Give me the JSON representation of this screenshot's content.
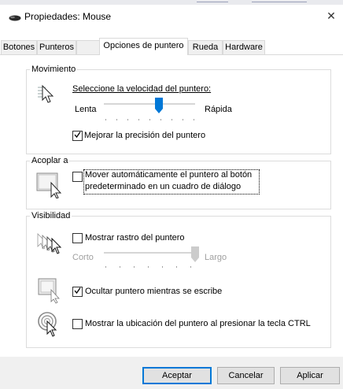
{
  "window": {
    "title": "Propiedades: Mouse",
    "close_symbol": "✕"
  },
  "tabs": [
    {
      "label": "Botones"
    },
    {
      "label": "Punteros"
    },
    {
      "label": "Opciones de puntero"
    },
    {
      "label": "Rueda"
    },
    {
      "label": "Hardware"
    }
  ],
  "active_tab": "Opciones de puntero",
  "motion": {
    "legend": "Movimiento",
    "speed_label": "Seleccione la velocidad del puntero:",
    "slow_label": "Lenta",
    "fast_label": "Rápida",
    "speed_value": 0.6,
    "precision_label": "Mejorar la precisión del puntero",
    "precision_checked": true
  },
  "snap_to": {
    "legend": "Acoplar a",
    "label_line1": "Mover automáticamente el puntero al botón",
    "label_line2": "predeterminado en un cuadro de diálogo",
    "checked": false
  },
  "visibility": {
    "legend": "Visibilidad",
    "trails_label": "Mostrar rastro del puntero",
    "trails_checked": false,
    "short_label": "Corto",
    "long_label": "Largo",
    "trails_value": 1.0,
    "hide_typing_label": "Ocultar puntero mientras se escribe",
    "hide_typing_checked": true,
    "show_location_label": "Mostrar la ubicación del puntero al presionar la tecla CTRL",
    "show_location_checked": false
  },
  "buttons": {
    "ok": "Aceptar",
    "cancel": "Cancelar",
    "apply": "Aplicar"
  },
  "colors": {
    "accent": "#0078d7",
    "border": "#dcdcdc",
    "disabled_text": "#a0a0a0"
  },
  "icons": {
    "title": "mouse-icon",
    "speed": "pointer-speed-icon",
    "snap": "snap-to-button-icon",
    "trails": "pointer-trails-icon",
    "hide": "hide-pointer-icon",
    "location": "pointer-location-icon"
  }
}
